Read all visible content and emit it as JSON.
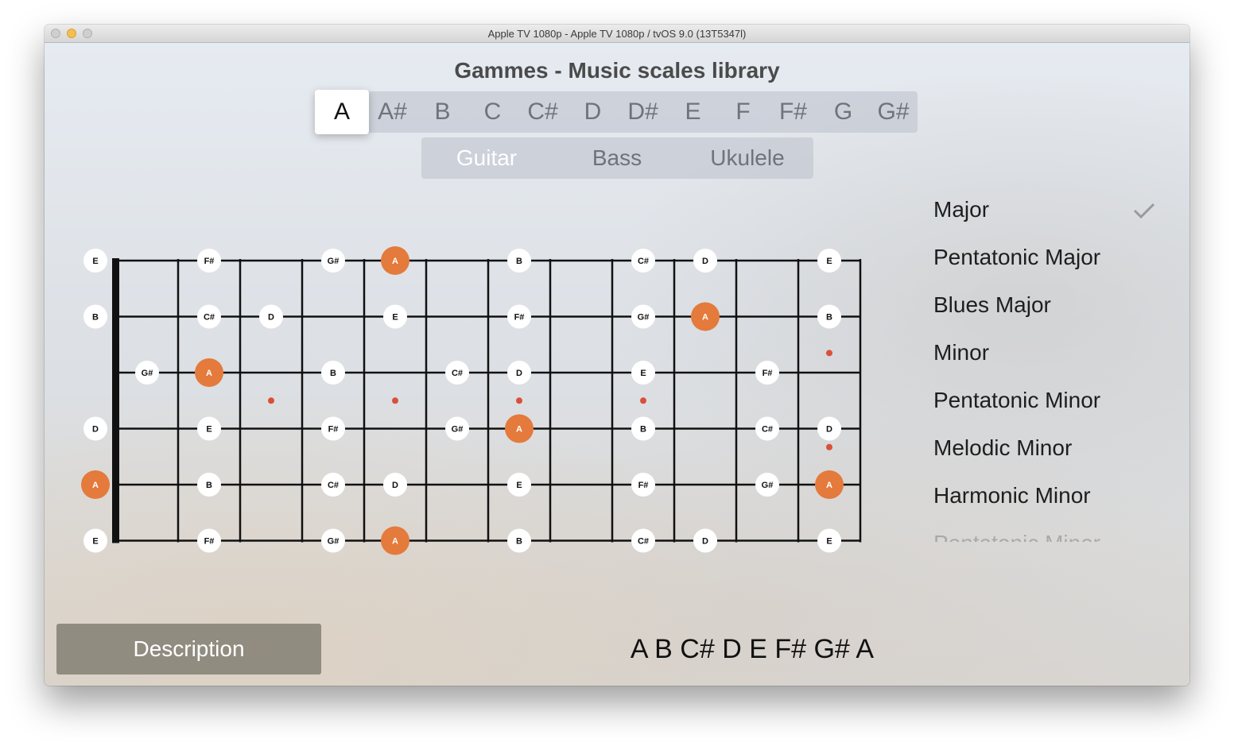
{
  "window": {
    "title": "Apple TV 1080p - Apple TV 1080p / tvOS 9.0 (13T5347l)"
  },
  "app": {
    "title": "Gammes - Music scales library"
  },
  "keys": {
    "items": [
      "A",
      "A#",
      "B",
      "C",
      "C#",
      "D",
      "D#",
      "E",
      "F",
      "F#",
      "G",
      "G#"
    ],
    "selected": "A"
  },
  "instruments": {
    "items": [
      "Guitar",
      "Bass",
      "Ukulele"
    ],
    "selected": "Guitar"
  },
  "scales": {
    "items": [
      "Major",
      "Pentatonic Major",
      "Blues Major",
      "Minor",
      "Pentatonic Minor",
      "Melodic Minor",
      "Harmonic Minor",
      "Pentatonic Minor"
    ],
    "selected": "Major"
  },
  "fretboard": {
    "strings": [
      {
        "open": "E",
        "notes": [
          {
            "fret": 2,
            "note": "F#"
          },
          {
            "fret": 4,
            "note": "G#"
          },
          {
            "fret": 5,
            "note": "A",
            "root": true
          },
          {
            "fret": 7,
            "note": "B"
          },
          {
            "fret": 9,
            "note": "C#"
          },
          {
            "fret": 10,
            "note": "D"
          },
          {
            "fret": 12,
            "note": "E"
          }
        ]
      },
      {
        "open": "B",
        "notes": [
          {
            "fret": 2,
            "note": "C#"
          },
          {
            "fret": 3,
            "note": "D"
          },
          {
            "fret": 5,
            "note": "E"
          },
          {
            "fret": 7,
            "note": "F#"
          },
          {
            "fret": 9,
            "note": "G#"
          },
          {
            "fret": 10,
            "note": "A",
            "root": true
          },
          {
            "fret": 12,
            "note": "B"
          }
        ]
      },
      {
        "open": "",
        "notes": [
          {
            "fret": 1,
            "note": "G#"
          },
          {
            "fret": 2,
            "note": "A",
            "root": true
          },
          {
            "fret": 4,
            "note": "B"
          },
          {
            "fret": 6,
            "note": "C#"
          },
          {
            "fret": 7,
            "note": "D"
          },
          {
            "fret": 9,
            "note": "E"
          },
          {
            "fret": 11,
            "note": "F#"
          }
        ]
      },
      {
        "open": "D",
        "notes": [
          {
            "fret": 2,
            "note": "E"
          },
          {
            "fret": 4,
            "note": "F#"
          },
          {
            "fret": 6,
            "note": "G#"
          },
          {
            "fret": 7,
            "note": "A",
            "root": true
          },
          {
            "fret": 9,
            "note": "B"
          },
          {
            "fret": 11,
            "note": "C#"
          },
          {
            "fret": 12,
            "note": "D"
          }
        ]
      },
      {
        "open": "A",
        "open_root": true,
        "notes": [
          {
            "fret": 2,
            "note": "B"
          },
          {
            "fret": 4,
            "note": "C#"
          },
          {
            "fret": 5,
            "note": "D"
          },
          {
            "fret": 7,
            "note": "E"
          },
          {
            "fret": 9,
            "note": "F#"
          },
          {
            "fret": 11,
            "note": "G#"
          },
          {
            "fret": 12,
            "note": "A",
            "root": true
          }
        ]
      },
      {
        "open": "E",
        "notes": [
          {
            "fret": 2,
            "note": "F#"
          },
          {
            "fret": 4,
            "note": "G#"
          },
          {
            "fret": 5,
            "note": "A",
            "root": true
          },
          {
            "fret": 7,
            "note": "B"
          },
          {
            "fret": 9,
            "note": "C#"
          },
          {
            "fret": 10,
            "note": "D"
          },
          {
            "fret": 12,
            "note": "E"
          }
        ]
      }
    ],
    "inlays": [
      3,
      5,
      7,
      9,
      12
    ],
    "root_color": "#e47a3b",
    "inlay_color": "#d9503a"
  },
  "description_button": "Description",
  "scale_notes": "A B C# D E F# G# A"
}
